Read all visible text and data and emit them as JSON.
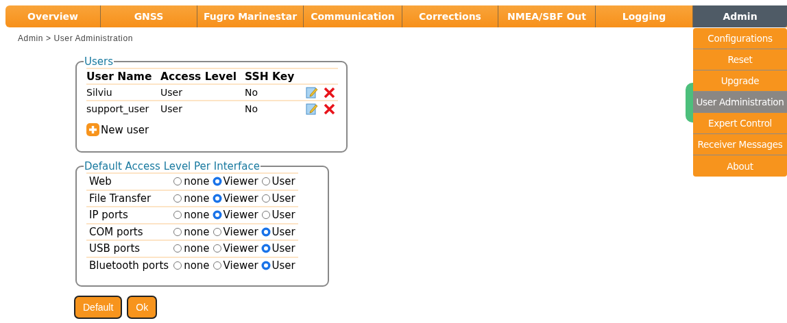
{
  "nav": {
    "tabs": [
      {
        "label": "Overview",
        "selected": false
      },
      {
        "label": "GNSS",
        "selected": false
      },
      {
        "label": "Fugro Marinestar",
        "selected": false
      },
      {
        "label": "Communication",
        "selected": false
      },
      {
        "label": "Corrections",
        "selected": false
      },
      {
        "label": "NMEA/SBF Out",
        "selected": false
      },
      {
        "label": "Logging",
        "selected": false
      },
      {
        "label": "Admin",
        "selected": true
      }
    ],
    "menu": [
      {
        "label": "Configurations",
        "selected": false
      },
      {
        "label": "Reset",
        "selected": false
      },
      {
        "label": "Upgrade",
        "selected": false
      },
      {
        "label": "User Administration",
        "selected": true
      },
      {
        "label": "Expert Control",
        "selected": false
      },
      {
        "label": "Receiver Messages",
        "selected": false
      },
      {
        "label": "About",
        "selected": false
      }
    ]
  },
  "breadcrumb": "Admin > User Administration",
  "users": {
    "title": "Users",
    "columns": [
      "User Name",
      "Access Level",
      "SSH Key"
    ],
    "rows": [
      [
        "Silviu",
        "User",
        "No"
      ],
      [
        "support_user",
        "User",
        "No"
      ]
    ],
    "new_user": "New user"
  },
  "access": {
    "title": "Default Access Level Per Interface",
    "rows": [
      {
        "label": "Web",
        "options": [
          {
            "label": "none",
            "selected": false
          },
          {
            "label": "Viewer",
            "selected": true
          },
          {
            "label": "User",
            "selected": false
          }
        ]
      },
      {
        "label": "File Transfer",
        "options": [
          {
            "label": "none",
            "selected": false
          },
          {
            "label": "Viewer",
            "selected": true
          },
          {
            "label": "User",
            "selected": false
          }
        ]
      },
      {
        "label": "IP ports",
        "options": [
          {
            "label": "none",
            "selected": false
          },
          {
            "label": "Viewer",
            "selected": true
          },
          {
            "label": "User",
            "selected": false
          }
        ]
      },
      {
        "label": "COM ports",
        "options": [
          {
            "label": "none",
            "selected": false
          },
          {
            "label": "Viewer",
            "selected": false
          },
          {
            "label": "User",
            "selected": true
          }
        ]
      },
      {
        "label": "USB ports",
        "options": [
          {
            "label": "none",
            "selected": false
          },
          {
            "label": "Viewer",
            "selected": false
          },
          {
            "label": "User",
            "selected": true
          }
        ]
      },
      {
        "label": "Bluetooth ports",
        "options": [
          {
            "label": "none",
            "selected": false
          },
          {
            "label": "Viewer",
            "selected": false
          },
          {
            "label": "User",
            "selected": true
          }
        ]
      }
    ]
  },
  "buttons": [
    "Default",
    "Ok"
  ]
}
